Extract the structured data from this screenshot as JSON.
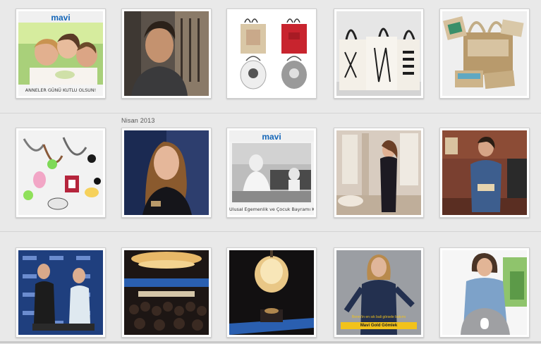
{
  "sections": [
    {
      "label": ""
    },
    {
      "label": "Nisan 2013"
    },
    {
      "label": ""
    }
  ],
  "thumbnails": {
    "row1": [
      {
        "name": "mothers-day-card",
        "logo": "mavi",
        "caption": "ANNELER GÜNÜ KUTLU OLSUN!"
      },
      {
        "name": "man-portrait"
      },
      {
        "name": "tote-bags-four"
      },
      {
        "name": "canvas-tote-bags"
      },
      {
        "name": "jute-bags"
      }
    ],
    "row2": [
      {
        "name": "necklaces"
      },
      {
        "name": "woman-portrait"
      },
      {
        "name": "childrens-day-card",
        "logo": "mavi",
        "caption": "Ulusal Egemenlik ve Çocuk Bayramı Kutlu Olsun!"
      },
      {
        "name": "woman-in-room"
      },
      {
        "name": "man-reading"
      }
    ],
    "row3": [
      {
        "name": "two-men-on-stage"
      },
      {
        "name": "event-crowd"
      },
      {
        "name": "chandelier-stage"
      },
      {
        "name": "woman-gold-campaign",
        "badge_sub": "Beren'in en sık bali görsele bakımı",
        "badge": "Mavi Gold Gömlek"
      },
      {
        "name": "woman-with-bag"
      }
    ]
  }
}
